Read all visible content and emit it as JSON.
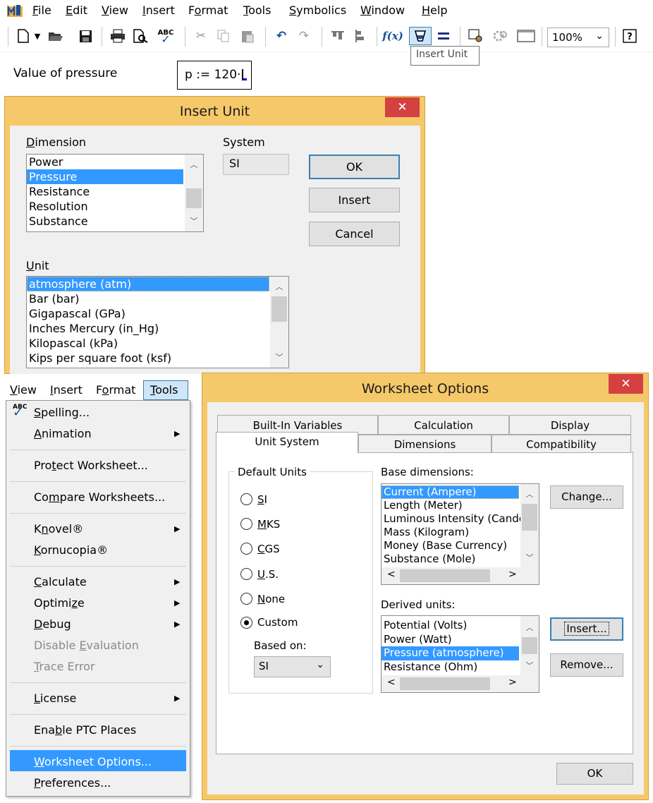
{
  "menubar": {
    "items": [
      "File",
      "Edit",
      "View",
      "Insert",
      "Format",
      "Tools",
      "Symbolics",
      "Window",
      "Help"
    ],
    "mnemonics": [
      "F",
      "E",
      "V",
      "I",
      "o",
      "T",
      "S",
      "W",
      "H"
    ]
  },
  "toolbar": {
    "zoom": "100%",
    "tooltip": "Insert Unit"
  },
  "worksheet": {
    "label": "Value of pressure",
    "expression": "p := 120·"
  },
  "insert_unit": {
    "title": "Insert Unit",
    "dimension_label": "Dimension",
    "dimensions": [
      "Power",
      "Pressure",
      "Resistance",
      "Resolution",
      "Substance"
    ],
    "selected_dimension": "Pressure",
    "system_label": "System",
    "system_value": "SI",
    "buttons": {
      "ok": "OK",
      "insert": "Insert",
      "cancel": "Cancel"
    },
    "unit_label": "Unit",
    "units": [
      "atmosphere (atm)",
      "Bar (bar)",
      "Gigapascal (GPa)",
      "Inches Mercury (in_Hg)",
      "Kilopascal (kPa)",
      "Kips per square foot (ksf)"
    ],
    "selected_unit": "atmosphere (atm)"
  },
  "tools_menu": {
    "bar_items": [
      "View",
      "Insert",
      "Format",
      "Tools"
    ],
    "open_menu": "Tools",
    "items": [
      {
        "label": "Spelling...",
        "submenu": false,
        "disabled": false
      },
      {
        "label": "Animation",
        "submenu": true,
        "disabled": false
      },
      {
        "label": "Protect Worksheet...",
        "submenu": false,
        "disabled": false
      },
      {
        "label": "Compare Worksheets...",
        "submenu": false,
        "disabled": false
      },
      {
        "label": "Knovel®",
        "submenu": true,
        "disabled": false
      },
      {
        "label": "Kornucopia®",
        "submenu": false,
        "disabled": false
      },
      {
        "label": "Calculate",
        "submenu": true,
        "disabled": false
      },
      {
        "label": "Optimize",
        "submenu": true,
        "disabled": false
      },
      {
        "label": "Debug",
        "submenu": true,
        "disabled": false
      },
      {
        "label": "Disable Evaluation",
        "submenu": false,
        "disabled": true
      },
      {
        "label": "Trace Error",
        "submenu": false,
        "disabled": true
      },
      {
        "label": "License",
        "submenu": true,
        "disabled": false
      },
      {
        "label": "Enable PTC Places",
        "submenu": false,
        "disabled": false
      },
      {
        "label": "Worksheet Options...",
        "submenu": false,
        "disabled": false,
        "highlighted": true
      },
      {
        "label": "Preferences...",
        "submenu": false,
        "disabled": false
      }
    ]
  },
  "worksheet_options": {
    "title": "Worksheet Options",
    "tabs_row1": [
      "Built-In Variables",
      "Calculation",
      "Display"
    ],
    "tabs_row2": [
      "Unit System",
      "Dimensions",
      "Compatibility"
    ],
    "active_tab": "Unit System",
    "default_units_label": "Default Units",
    "radio_options": [
      "SI",
      "MKS",
      "CGS",
      "U.S.",
      "None",
      "Custom"
    ],
    "selected_radio": "Custom",
    "based_on_label": "Based on:",
    "based_on_value": "SI",
    "base_dimensions_label": "Base dimensions:",
    "base_dimensions": [
      "Current (Ampere)",
      "Length (Meter)",
      "Luminous Intensity (Candela)",
      "Mass (Kilogram)",
      "Money (Base Currency)",
      "Substance (Mole)"
    ],
    "selected_base": "Current (Ampere)",
    "change_button": "Change...",
    "derived_units_label": "Derived units:",
    "derived_units": [
      "Potential (Volts)",
      "Power (Watt)",
      "Pressure (atmosphere)",
      "Resistance (Ohm)"
    ],
    "selected_derived": "Pressure (atmosphere)",
    "insert_button": "Insert...",
    "remove_button": "Remove...",
    "ok_button": "OK"
  },
  "colors": {
    "dialog_frame": "#f5c86a",
    "close_button": "#d54040",
    "selection": "#3399ff"
  }
}
